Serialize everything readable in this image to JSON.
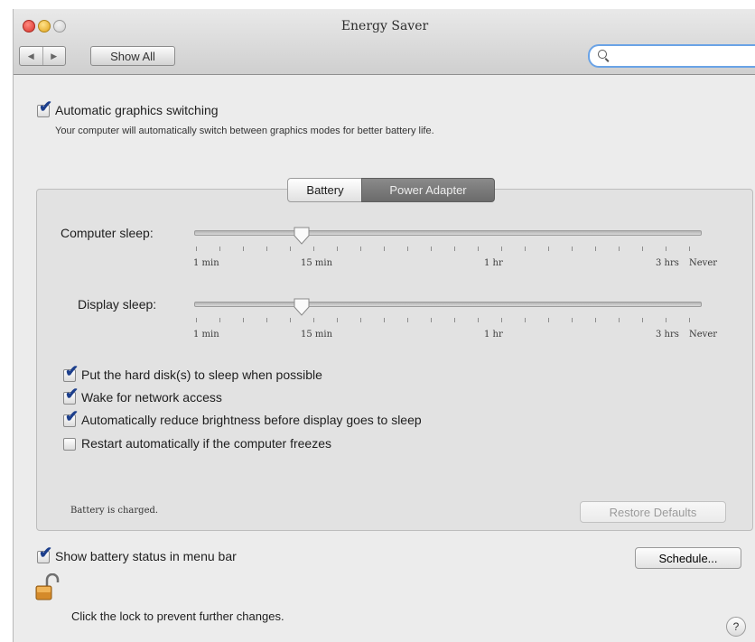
{
  "window": {
    "title": "Energy Saver",
    "nav_back_icon": "◀",
    "nav_forward_icon": "▶",
    "show_all_label": "Show All",
    "search_placeholder": ""
  },
  "graphics": {
    "label": "Automatic graphics switching",
    "checked": true,
    "description": "Your computer will automatically switch between graphics modes for better battery life."
  },
  "tabs": [
    {
      "label": "Battery",
      "selected": false
    },
    {
      "label": "Power Adapter",
      "selected": true
    }
  ],
  "sliders": {
    "computer_sleep": {
      "label": "Computer sleep:",
      "value": "15 min"
    },
    "display_sleep": {
      "label": "Display sleep:",
      "value": "15 min"
    },
    "tick_labels": [
      "1 min",
      "15 min",
      "1 hr",
      "3 hrs",
      "Never"
    ]
  },
  "options": [
    {
      "label": "Put the hard disk(s) to sleep when possible",
      "checked": true
    },
    {
      "label": "Wake for network access",
      "checked": true
    },
    {
      "label": "Automatically reduce brightness before display goes to sleep",
      "checked": true
    },
    {
      "label": "Restart automatically if the computer freezes",
      "checked": false
    }
  ],
  "status_text": "Battery is charged.",
  "restore_defaults_label": "Restore Defaults",
  "battery_status": {
    "label": "Show battery status in menu bar",
    "checked": true
  },
  "schedule_label": "Schedule...",
  "lock_text": "Click the lock to prevent further changes.",
  "help_label": "?",
  "check_glyph": "✔",
  "colors": {
    "accent": "#1d3f8c",
    "selected_tab": "#6b6b6b",
    "search_focus": "#6aa3e6"
  }
}
